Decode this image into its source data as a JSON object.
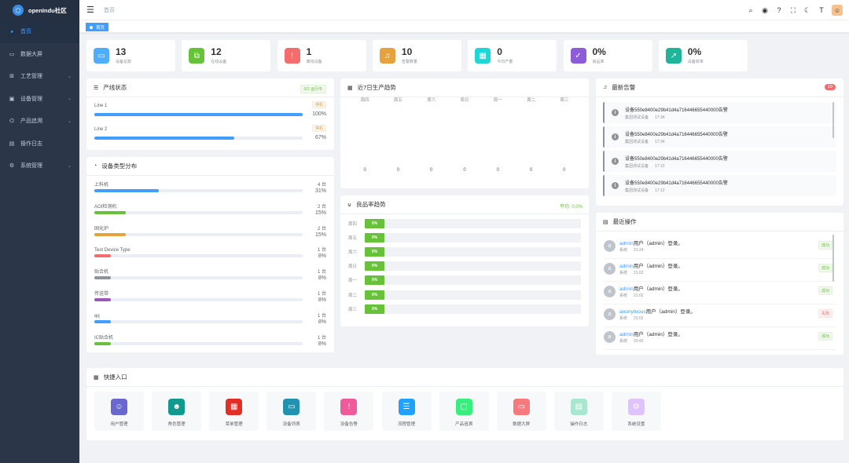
{
  "app": {
    "title": "openIndu社区",
    "logo_glyph": "⬡"
  },
  "sidebar": {
    "items": [
      {
        "label": "首页",
        "icon": "dashboard-icon",
        "glyph": "◕",
        "active": true,
        "has_children": false
      },
      {
        "label": "数据大屏",
        "icon": "monitor-icon",
        "glyph": "▭",
        "active": false,
        "has_children": false
      },
      {
        "label": "工艺管理",
        "icon": "process-icon",
        "glyph": "⊞",
        "active": false,
        "has_children": true
      },
      {
        "label": "设备管理",
        "icon": "device-icon",
        "glyph": "▣",
        "active": false,
        "has_children": true
      },
      {
        "label": "产品追溯",
        "icon": "trace-icon",
        "glyph": "⌬",
        "active": false,
        "has_children": true
      },
      {
        "label": "操作日志",
        "icon": "log-icon",
        "glyph": "▤",
        "active": false,
        "has_children": false
      },
      {
        "label": "系统管理",
        "icon": "gear-icon",
        "glyph": "⚙",
        "active": false,
        "has_children": true
      }
    ],
    "arrow_glyph": "⌄"
  },
  "topbar": {
    "breadcrumb": "首页",
    "icons": [
      {
        "name": "search-icon",
        "glyph": "⌕"
      },
      {
        "name": "github-icon",
        "glyph": "◉"
      },
      {
        "name": "help-icon",
        "glyph": "?"
      },
      {
        "name": "fullscreen-icon",
        "glyph": "⛶"
      },
      {
        "name": "theme-moon-icon",
        "glyph": "☾"
      },
      {
        "name": "font-size-icon",
        "glyph": "T"
      }
    ],
    "avatar_glyph": "☺"
  },
  "tags": {
    "active_tag": "首页"
  },
  "stats": [
    {
      "value": "13",
      "label": "设备总数",
      "color": "#4facfe",
      "icon": "monitor-icon",
      "glyph": "▭"
    },
    {
      "value": "12",
      "label": "在线设备",
      "color": "#67c23a",
      "icon": "link-icon",
      "glyph": "⧉"
    },
    {
      "value": "1",
      "label": "离线设备",
      "color": "#f56c6c",
      "icon": "warning-circle-icon",
      "glyph": "!"
    },
    {
      "value": "10",
      "label": "告警数量",
      "color": "#e6a23c",
      "icon": "bell-icon",
      "glyph": "♫"
    },
    {
      "value": "0",
      "label": "今日产量",
      "color": "#1dd6d6",
      "icon": "box-icon",
      "glyph": "▦"
    },
    {
      "value": "0%",
      "label": "良品率",
      "color": "#8e5cd9",
      "icon": "clipboard-icon",
      "glyph": "✓"
    },
    {
      "value": "0%",
      "label": "设备效率",
      "color": "#1fb59b",
      "icon": "trend-icon",
      "glyph": "↗"
    }
  ],
  "line_status": {
    "title": "产线状态",
    "badge": "0/2 运行中",
    "lines": [
      {
        "name": "Line 1",
        "status": "停机",
        "percent": 100,
        "percent_label": "100%",
        "color": "#409eff"
      },
      {
        "name": "Line 2",
        "status": "停机",
        "percent": 67,
        "percent_label": "67%",
        "color": "#409eff"
      }
    ]
  },
  "device_dist": {
    "title": "设备类型分布",
    "items": [
      {
        "name": "上料机",
        "count": "4 台",
        "percent": 31,
        "percent_label": "31%",
        "color": "#409eff"
      },
      {
        "name": "AOI检测机",
        "count": "2 台",
        "percent": 15,
        "percent_label": "15%",
        "color": "#67c23a"
      },
      {
        "name": "固化炉",
        "count": "2 台",
        "percent": 15,
        "percent_label": "15%",
        "color": "#e6a23c"
      },
      {
        "name": "Test Device Type",
        "count": "1 台",
        "percent": 8,
        "percent_label": "8%",
        "color": "#f56c6c"
      },
      {
        "name": "贴合机",
        "count": "1 台",
        "percent": 8,
        "percent_label": "8%",
        "color": "#909399"
      },
      {
        "name": "传送带",
        "count": "1 台",
        "percent": 8,
        "percent_label": "8%",
        "color": "#9b59b6"
      },
      {
        "name": "qq",
        "count": "1 台",
        "percent": 8,
        "percent_label": "8%",
        "color": "#409eff"
      },
      {
        "name": "IC贴合机",
        "count": "1 台",
        "percent": 8,
        "percent_label": "8%",
        "color": "#67c23a"
      }
    ]
  },
  "trend": {
    "title": "近7日生产趋势",
    "chart_data": {
      "type": "bar",
      "title": "近7日生产趋势",
      "categories": [
        "周四",
        "周五",
        "周六",
        "周日",
        "周一",
        "周二",
        "周三"
      ],
      "values": [
        0,
        0,
        0,
        0,
        0,
        0,
        0
      ],
      "value_labels": [
        "0",
        "0",
        "0",
        "0",
        "0",
        "0",
        "0"
      ]
    }
  },
  "yield": {
    "title": "良品率趋势",
    "avg_label": "平均: 0.0%",
    "chart_data": {
      "type": "bar",
      "title": "良品率趋势",
      "categories": [
        "周四",
        "周五",
        "周六",
        "周日",
        "周一",
        "周二",
        "周三"
      ],
      "values": [
        0,
        0,
        0,
        0,
        0,
        0,
        0
      ],
      "value_labels": [
        "0%",
        "0%",
        "0%",
        "0%",
        "0%",
        "0%",
        "0%"
      ]
    }
  },
  "alarms": {
    "title": "最新告警",
    "count": "10",
    "items": [
      {
        "title": "设备550e8400e29b41d4a716446655440000告警",
        "source": "集团测试设备",
        "time": "17:34"
      },
      {
        "title": "设备550e8400e29b41d4a716446655440000告警",
        "source": "集团测试设备",
        "time": "17:34"
      },
      {
        "title": "设备550e8400e29b41d4a716446655440000告警",
        "source": "集团测试设备",
        "time": "17:12"
      },
      {
        "title": "设备550e8400e29b41d4a716446655440000告警",
        "source": "集团测试设备",
        "time": "17:12"
      }
    ]
  },
  "operations": {
    "title": "最近操作",
    "items": [
      {
        "user": "admin",
        "action": "用户（admin）登录。",
        "module": "系统",
        "time": "21:24",
        "result": "成功",
        "ok": true
      },
      {
        "user": "admin",
        "action": "用户（admin）登录。",
        "module": "系统",
        "time": "21:02",
        "result": "成功",
        "ok": true
      },
      {
        "user": "admin",
        "action": "用户（admin）登录。",
        "module": "系统",
        "time": "21:02",
        "result": "成功",
        "ok": true
      },
      {
        "user": "anonymous",
        "action": "用户（admin）登录。",
        "module": "系统",
        "time": "21:02",
        "result": "失败",
        "ok": false
      },
      {
        "user": "admin",
        "action": "用户（admin）登录。",
        "module": "系统",
        "time": "20:42",
        "result": "成功",
        "ok": true
      }
    ]
  },
  "quick": {
    "title": "快捷入口",
    "items": [
      {
        "label": "用户管理",
        "icon": "user-icon",
        "glyph": "☺",
        "color": "#6a67ce"
      },
      {
        "label": "角色管理",
        "icon": "role-icon",
        "glyph": "☻",
        "color": "#11998e"
      },
      {
        "label": "菜单管理",
        "icon": "menu-grid-icon",
        "glyph": "▦",
        "color": "#e52d27"
      },
      {
        "label": "设备列表",
        "icon": "monitor-icon",
        "glyph": "▭",
        "color": "#2193b0"
      },
      {
        "label": "设备告警",
        "icon": "warning-circle-icon",
        "glyph": "!",
        "color": "#f05a9b"
      },
      {
        "label": "流程管理",
        "icon": "sliders-icon",
        "glyph": "☰",
        "color": "#1fa2ff"
      },
      {
        "label": "产品追溯",
        "icon": "box-icon",
        "glyph": "▢",
        "color": "#38ef7d"
      },
      {
        "label": "数据大屏",
        "icon": "screen-icon",
        "glyph": "▭",
        "color": "#f7797d"
      },
      {
        "label": "操作日志",
        "icon": "document-icon",
        "glyph": "▤",
        "color": "#a8e6cf"
      },
      {
        "label": "系统设置",
        "icon": "gear-icon",
        "glyph": "⚙",
        "color": "#e0c3fc"
      }
    ]
  }
}
